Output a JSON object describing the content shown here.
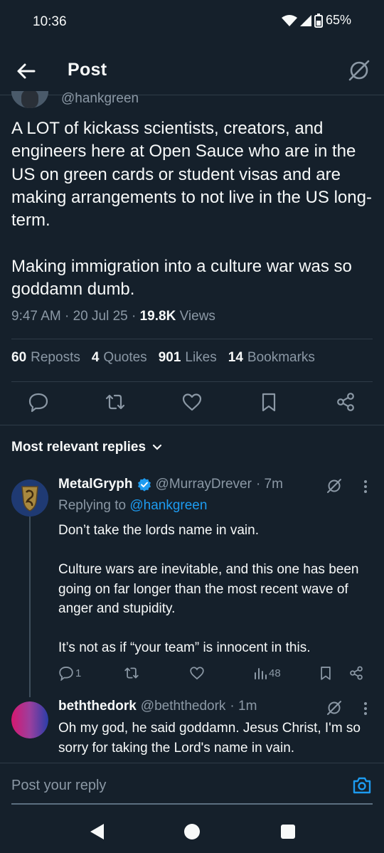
{
  "status": {
    "time": "10:36",
    "battery": "65%"
  },
  "topbar": {
    "title": "Post"
  },
  "post": {
    "handle": "@hankgreen",
    "text": "A LOT of kickass scientists, creators, and engineers here at Open Sauce who are in the US on green cards or student visas and are making arrangements to not live in the US long-term.\n\nMaking immigration into a culture war was so goddamn dumb.",
    "time": "9:47 AM · 20 Jul 25 · ",
    "views_count": "19.8K",
    "views_label": " Views",
    "stats": [
      {
        "count": "60",
        "label": "Reposts"
      },
      {
        "count": "4",
        "label": "Quotes"
      },
      {
        "count": "901",
        "label": "Likes"
      },
      {
        "count": "14",
        "label": "Bookmarks"
      }
    ]
  },
  "sort": {
    "label": "Most relevant replies"
  },
  "replies": [
    {
      "name": "MetalGryph",
      "handle": "@MurrayDrever",
      "age": "· 7m",
      "replying_prefix": "Replying to ",
      "replying_to": "@hankgreen",
      "text": "Don’t take the lords name in vain.\n\nCulture wars are inevitable, and this one has been going on far longer than the most recent wave of anger and stupidity.\n\nIt’s not as if “your team” is innocent in this.",
      "reply_count": "1",
      "view_count": "48"
    },
    {
      "name": "beththedork",
      "handle": "@beththedork",
      "age": "· 1m",
      "text": "Oh my god, he said goddamn. Jesus Christ, I'm so sorry for taking the Lord's name in vain."
    }
  ],
  "composer": {
    "placeholder": "Post your reply"
  },
  "colors": {
    "bg": "#15202b",
    "accent": "#1d9bf0",
    "muted": "#8b98a5",
    "verified": "#1d9bf0"
  }
}
